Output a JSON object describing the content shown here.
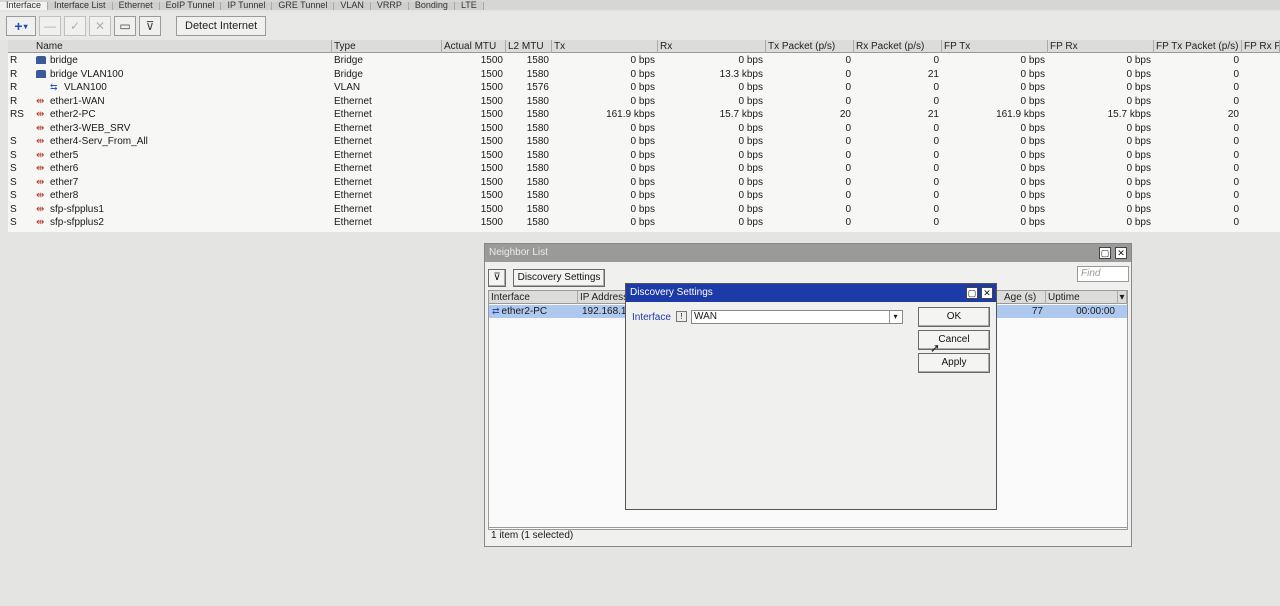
{
  "tabs": [
    "Interface",
    "Interface List",
    "Ethernet",
    "EoIP Tunnel",
    "IP Tunnel",
    "GRE Tunnel",
    "VLAN",
    "VRRP",
    "Bonding",
    "LTE"
  ],
  "toolbar": {
    "add_label": "+",
    "detect_label": "Detect Internet"
  },
  "columns": [
    "Name",
    "Type",
    "Actual MTU",
    "L2 MTU",
    "Tx",
    "Rx",
    "Tx Packet (p/s)",
    "Rx Packet (p/s)",
    "FP Tx",
    "FP Rx",
    "FP Tx Packet (p/s)",
    "FP Rx Pa"
  ],
  "rows": [
    {
      "flag": "R",
      "icon": "bridge-icon",
      "name": "bridge",
      "type": "Bridge",
      "amtu": "1500",
      "l2mtu": "1580",
      "tx": "0 bps",
      "rx": "0 bps",
      "txp": "0",
      "rxp": "0",
      "fptx": "0 bps",
      "fprx": "0 bps",
      "fptxp": "0"
    },
    {
      "flag": "R",
      "icon": "bridge-icon",
      "name": "bridge VLAN100",
      "type": "Bridge",
      "amtu": "1500",
      "l2mtu": "1580",
      "tx": "0 bps",
      "rx": "13.3 kbps",
      "txp": "0",
      "rxp": "21",
      "fptx": "0 bps",
      "fprx": "0 bps",
      "fptxp": "0"
    },
    {
      "flag": "R",
      "icon": "vlan-icon",
      "name": "VLAN100",
      "type": "VLAN",
      "amtu": "1500",
      "l2mtu": "1576",
      "tx": "0 bps",
      "rx": "0 bps",
      "txp": "0",
      "rxp": "0",
      "fptx": "0 bps",
      "fprx": "0 bps",
      "fptxp": "0"
    },
    {
      "flag": "R",
      "icon": "ethernet-icon",
      "name": "ether1-WAN",
      "type": "Ethernet",
      "amtu": "1500",
      "l2mtu": "1580",
      "tx": "0 bps",
      "rx": "0 bps",
      "txp": "0",
      "rxp": "0",
      "fptx": "0 bps",
      "fprx": "0 bps",
      "fptxp": "0"
    },
    {
      "flag": "RS",
      "icon": "ethernet-icon",
      "name": "ether2-PC",
      "type": "Ethernet",
      "amtu": "1500",
      "l2mtu": "1580",
      "tx": "161.9 kbps",
      "rx": "15.7 kbps",
      "txp": "20",
      "rxp": "21",
      "fptx": "161.9 kbps",
      "fprx": "15.7 kbps",
      "fptxp": "20"
    },
    {
      "flag": "",
      "icon": "ethernet-icon",
      "name": "ether3-WEB_SRV",
      "type": "Ethernet",
      "amtu": "1500",
      "l2mtu": "1580",
      "tx": "0 bps",
      "rx": "0 bps",
      "txp": "0",
      "rxp": "0",
      "fptx": "0 bps",
      "fprx": "0 bps",
      "fptxp": "0"
    },
    {
      "flag": "S",
      "icon": "ethernet-icon",
      "name": "ether4-Serv_From_All",
      "type": "Ethernet",
      "amtu": "1500",
      "l2mtu": "1580",
      "tx": "0 bps",
      "rx": "0 bps",
      "txp": "0",
      "rxp": "0",
      "fptx": "0 bps",
      "fprx": "0 bps",
      "fptxp": "0"
    },
    {
      "flag": "S",
      "icon": "ethernet-icon",
      "name": "ether5",
      "type": "Ethernet",
      "amtu": "1500",
      "l2mtu": "1580",
      "tx": "0 bps",
      "rx": "0 bps",
      "txp": "0",
      "rxp": "0",
      "fptx": "0 bps",
      "fprx": "0 bps",
      "fptxp": "0"
    },
    {
      "flag": "S",
      "icon": "ethernet-icon",
      "name": "ether6",
      "type": "Ethernet",
      "amtu": "1500",
      "l2mtu": "1580",
      "tx": "0 bps",
      "rx": "0 bps",
      "txp": "0",
      "rxp": "0",
      "fptx": "0 bps",
      "fprx": "0 bps",
      "fptxp": "0"
    },
    {
      "flag": "S",
      "icon": "ethernet-icon",
      "name": "ether7",
      "type": "Ethernet",
      "amtu": "1500",
      "l2mtu": "1580",
      "tx": "0 bps",
      "rx": "0 bps",
      "txp": "0",
      "rxp": "0",
      "fptx": "0 bps",
      "fprx": "0 bps",
      "fptxp": "0"
    },
    {
      "flag": "S",
      "icon": "ethernet-icon",
      "name": "ether8",
      "type": "Ethernet",
      "amtu": "1500",
      "l2mtu": "1580",
      "tx": "0 bps",
      "rx": "0 bps",
      "txp": "0",
      "rxp": "0",
      "fptx": "0 bps",
      "fprx": "0 bps",
      "fptxp": "0"
    },
    {
      "flag": "S",
      "icon": "ethernet-icon",
      "name": "sfp-sfpplus1",
      "type": "Ethernet",
      "amtu": "1500",
      "l2mtu": "1580",
      "tx": "0 bps",
      "rx": "0 bps",
      "txp": "0",
      "rxp": "0",
      "fptx": "0 bps",
      "fprx": "0 bps",
      "fptxp": "0"
    },
    {
      "flag": "S",
      "icon": "ethernet-icon",
      "name": "sfp-sfpplus2",
      "type": "Ethernet",
      "amtu": "1500",
      "l2mtu": "1580",
      "tx": "0 bps",
      "rx": "0 bps",
      "txp": "0",
      "rxp": "0",
      "fptx": "0 bps",
      "fprx": "0 bps",
      "fptxp": "0"
    }
  ],
  "neighbor_list": {
    "title": "Neighbor List",
    "discovery_button": "Discovery Settings",
    "find_placeholder": "Find",
    "columns": [
      "Interface",
      "IP Address",
      "Age (s)",
      "Uptime"
    ],
    "row": {
      "interface": "ether2-PC",
      "ip": "192.168.10",
      "age": "77",
      "uptime": "00:00:00"
    },
    "status": "1 item (1 selected)"
  },
  "discovery_settings": {
    "title": "Discovery Settings",
    "interface_label": "Interface",
    "interface_value": "WAN",
    "ok_label": "OK",
    "cancel_label": "Cancel",
    "apply_label": "Apply"
  }
}
